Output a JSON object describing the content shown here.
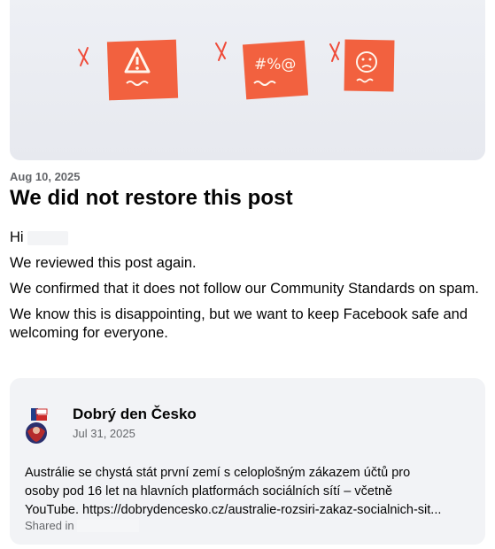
{
  "notice": {
    "date": "Aug 10, 2025",
    "title": "We did not restore this post",
    "greeting": "Hi",
    "paragraphs": [
      "We reviewed this post again.",
      "We confirmed that it does not follow our Community Standards on spam.",
      "We know this is disappointing, but we want to keep Facebook safe and welcoming for everyone."
    ]
  },
  "shared_post": {
    "author": "Dobrý den Česko",
    "date": "Jul 31, 2025",
    "text_lines": [
      "Austrálie se chystá stát první zemí s celoplošným zákazem účtů pro",
      "osoby pod 16 let na hlavních platformách sociálních sítí – včetně",
      "YouTube. https://dobrydencesko.cz/australie-rozsiri-zakaz-socialnich-sit..."
    ],
    "footer": "Shared in"
  },
  "colors": {
    "accent_red": "#f0603f",
    "text_primary": "#050505",
    "text_secondary": "#65676b",
    "card_bg": "#f2f3f6"
  }
}
